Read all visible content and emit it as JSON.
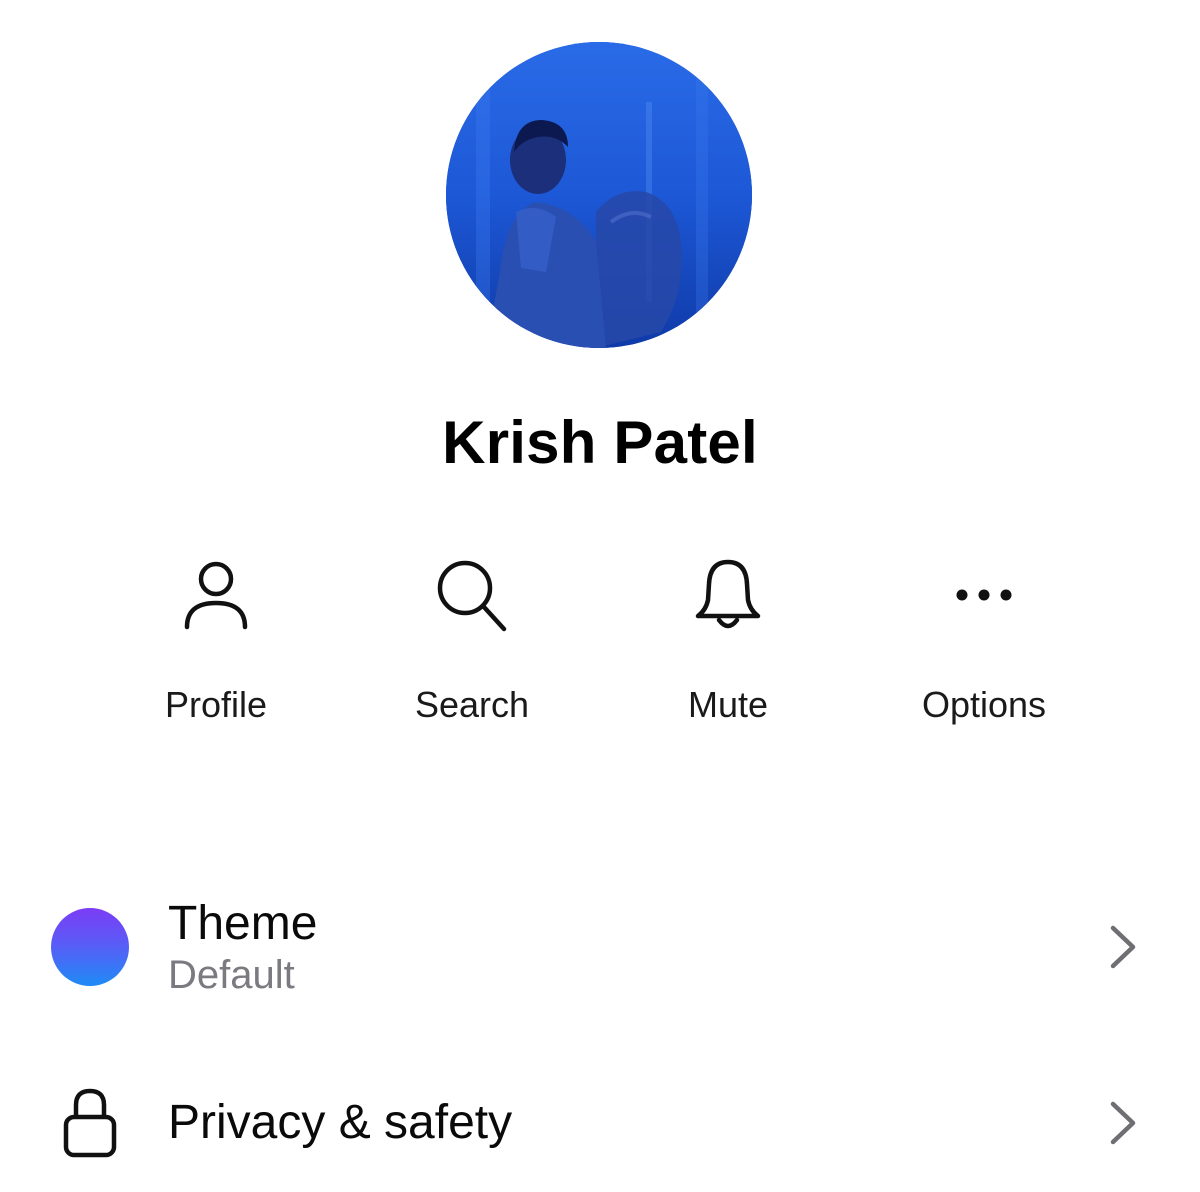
{
  "profile": {
    "name": "Krish Patel",
    "avatar_icon": "profile-photo"
  },
  "actions": [
    {
      "label": "Profile",
      "icon": "person-icon"
    },
    {
      "label": "Search",
      "icon": "search-icon"
    },
    {
      "label": "Mute",
      "icon": "bell-icon"
    },
    {
      "label": "Options",
      "icon": "more-icon"
    }
  ],
  "settings": [
    {
      "title": "Theme",
      "subtitle": "Default",
      "icon": "theme-color-dot",
      "accent_top": "#7b3cf5",
      "accent_bottom": "#1f8bf5"
    },
    {
      "title": "Privacy & safety",
      "icon": "lock-icon"
    }
  ],
  "colors": {
    "text": "#0a0a0a",
    "secondary_text": "#7a7a80",
    "chevron": "#6e6e73"
  }
}
